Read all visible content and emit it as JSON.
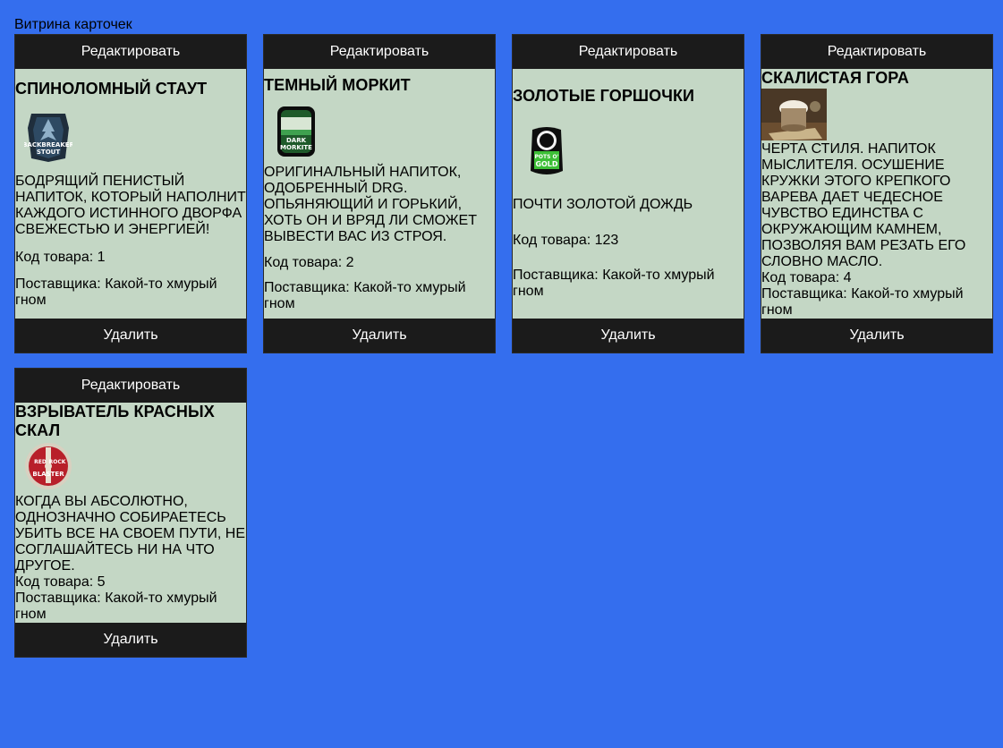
{
  "page_title": "Витрина карточек",
  "colors": {
    "background": "#346eee",
    "card_body": "#c4d7c5",
    "button": "#1b1b1b"
  },
  "cards": [
    {
      "edit_label": "Редактировать",
      "title": "СПИНОЛОМНЫЙ СТАУТ",
      "image": "backbreaker-stout-logo",
      "image_text": [
        "BACKBREAKER",
        "STOUT"
      ],
      "description": "БОДРЯЩИЙ ПЕНИСТЫЙ НАПИТОК, КОТОРЫЙ НАПОЛНИТ КАЖДОГО ИСТИННОГО ДВОРФА СВЕЖЕСТЬЮ И ЭНЕРГИЕЙ!",
      "code": "Код товара: 1",
      "supplier": "Поставщика: Какой-то хмурый гном",
      "delete_label": "Удалить"
    },
    {
      "edit_label": "Редактировать",
      "title": "ТЕМНЫЙ МОРКИТ",
      "image": "dark-morkite-logo",
      "image_text": [
        "DARK",
        "MORKITE"
      ],
      "description": "ОРИГИНАЛЬНЫЙ НАПИТОК, ОДОБРЕННЫЙ DRG. ОПЬЯНЯЮЩИЙ И ГОРЬКИЙ, ХОТЬ ОН И ВРЯД ЛИ СМОЖЕТ ВЫВЕСТИ ВАС ИЗ СТРОЯ.",
      "code": "Код товара: 2",
      "supplier": "Поставщика: Какой-то хмурый гном",
      "delete_label": "Удалить"
    },
    {
      "edit_label": "Редактировать",
      "title": "ЗОЛОТЫЕ ГОРШОЧКИ",
      "image": "pots-o-gold-logo",
      "image_text": [
        "POTS O'",
        "GOLD"
      ],
      "description": "ПОЧТИ ЗОЛОТОЙ ДОЖДЬ",
      "code": "Код товара: 123",
      "supplier": "Поставщика: Какой-то хмурый гном",
      "delete_label": "Удалить"
    },
    {
      "edit_label": "Редактировать",
      "title": "СКАЛИСТАЯ ГОРА",
      "image": "rocky-mountain-mug-photo",
      "description": "ЧЕРТА СТИЛЯ. НАПИТОК МЫСЛИТЕЛЯ. ОСУШЕНИЕ КРУЖКИ ЭТОГО КРЕПКОГО ВАРЕВА ДАЕТ ЧЕДЕСНОЕ ЧУВСТВО ЕДИНСТВА С ОКРУЖАЮЩИМ КАМНЕМ, ПОЗВОЛЯЯ ВАМ РЕЗАТЬ ЕГО СЛОВНО МАСЛО.",
      "code": "Код товара: 4",
      "supplier": "Поставщика: Какой-то хмурый гном",
      "delete_label": "Удалить"
    },
    {
      "edit_label": "Редактировать",
      "title": "ВЗРЫВАТЕЛЬ КРАСНЫХ СКАЛ",
      "image": "red-rock-blaster-logo",
      "image_text": [
        "RED",
        "ROCK",
        "BLASTER"
      ],
      "description": "КОГДА ВЫ АБСОЛЮТНО, ОДНОЗНАЧНО СОБИРАЕТЕСЬ УБИТЬ ВСЕ НА СВОЕМ ПУТИ, НЕ СОГЛАШАЙТЕСЬ НИ НА ЧТО ДРУГОЕ.",
      "code": "Код товара: 5",
      "supplier": "Поставщика: Какой-то хмурый гном",
      "delete_label": "Удалить"
    }
  ]
}
